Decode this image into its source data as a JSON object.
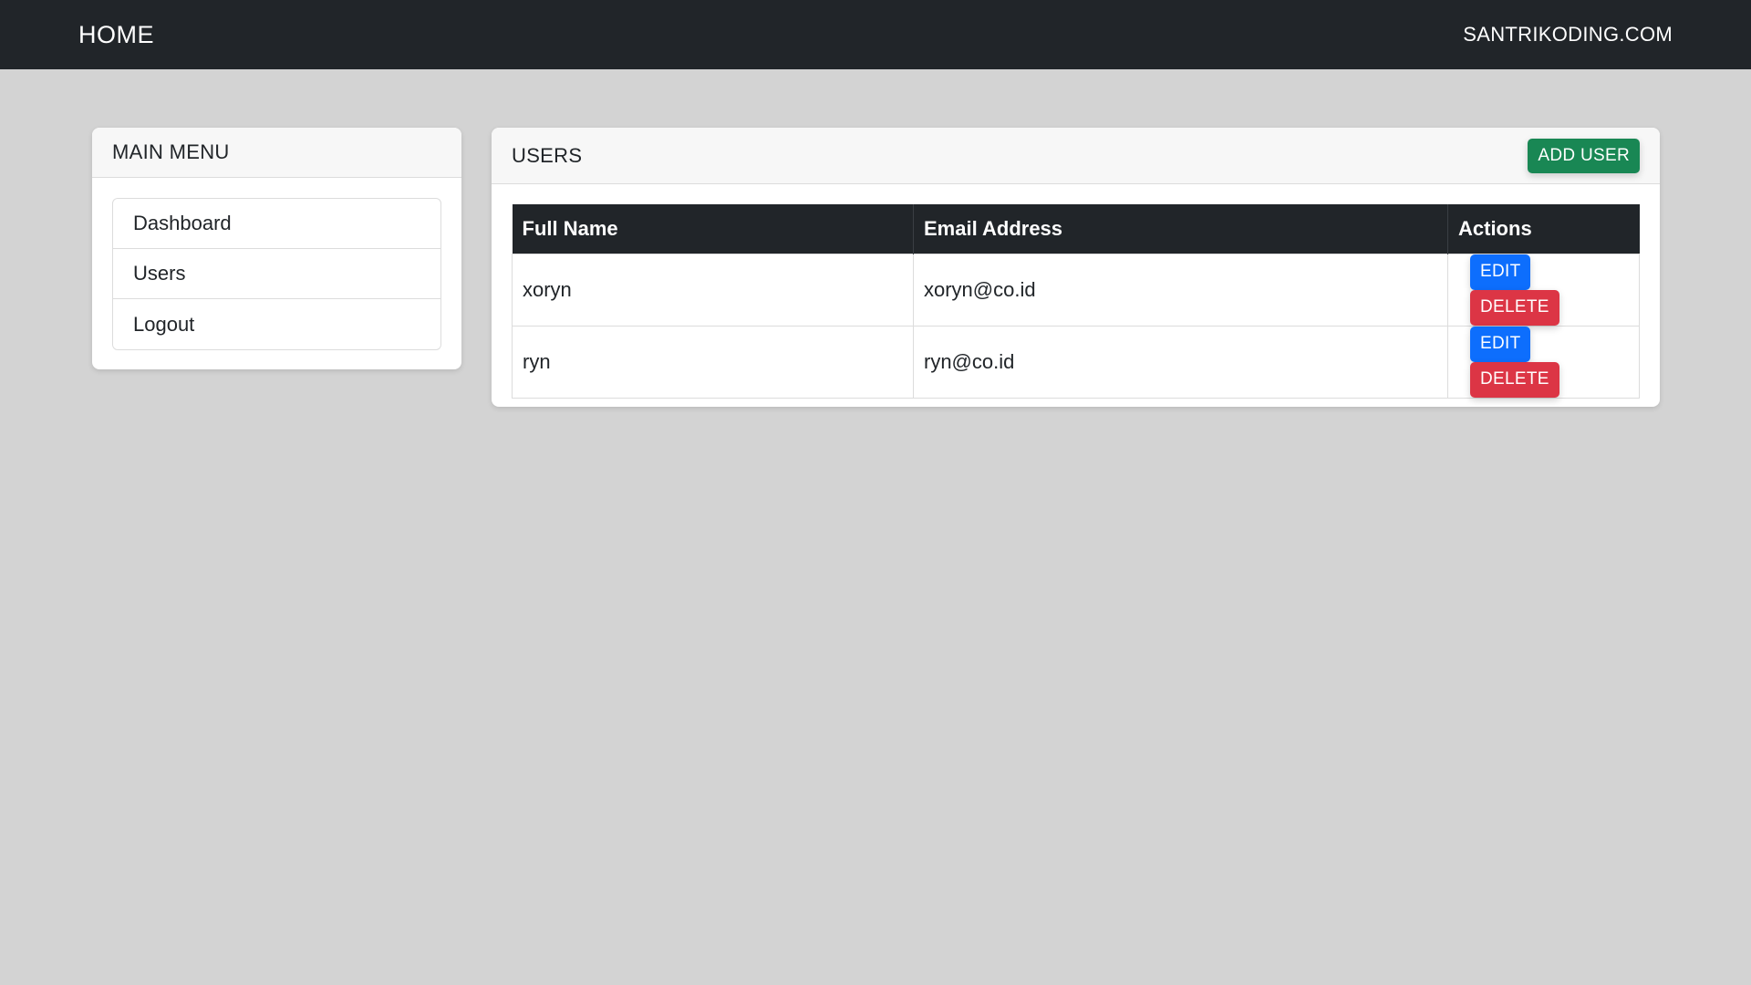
{
  "navbar": {
    "brand": "HOME",
    "right_link": "SANTRIKODING.COM",
    "background": "#212529"
  },
  "sidebar": {
    "title": "MAIN MENU",
    "items": [
      {
        "label": "Dashboard"
      },
      {
        "label": "Users"
      },
      {
        "label": "Logout"
      }
    ]
  },
  "users": {
    "title": "USERS",
    "add_button": "ADD USER",
    "columns": [
      "Full Name",
      "Email Address",
      "Actions"
    ],
    "rows": [
      {
        "name": "xoryn",
        "email": "xoryn@co.id",
        "edit": "EDIT",
        "delete": "DELETE"
      },
      {
        "name": "ryn",
        "email": "ryn@co.id",
        "edit": "EDIT",
        "delete": "DELETE"
      }
    ]
  },
  "colors": {
    "page_background": "#d3d3d3",
    "success": "#198754",
    "primary": "#0d6efd",
    "danger": "#dc3545"
  }
}
